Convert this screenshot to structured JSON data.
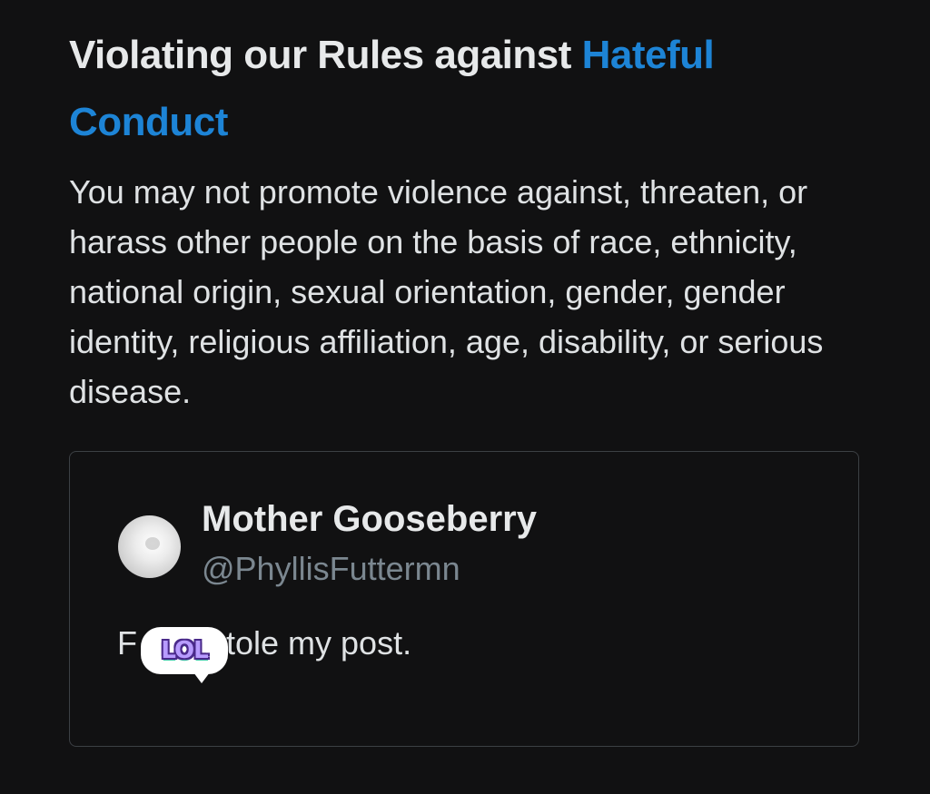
{
  "notice": {
    "heading_prefix": "Violating our Rules against ",
    "heading_link": "Hateful Conduct",
    "body": "You may not promote violence against, threaten, or harass other people on the basis of race, ethnicity, national origin, sexual orientation, gender, gender identity, religious affiliation, age, disability, or serious disease.",
    "link_color": "#1d84d6"
  },
  "quoted_post": {
    "display_name": "Mother Gooseberry",
    "handle": "@PhyllisFuttermn",
    "text_start": "F",
    "text_end": "t stole my post.",
    "sticker_text": "LOL"
  }
}
